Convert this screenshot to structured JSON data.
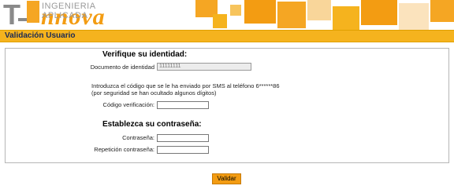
{
  "brand": {
    "logo_text": "T-Innova",
    "tagline": "INGENIERIA APLICADA"
  },
  "colors": {
    "accent": "#f5b31e",
    "orange": "#f39c12",
    "title_text": "#1b2a55"
  },
  "header": {
    "title": "Validación Usuario"
  },
  "identity": {
    "heading": "Verifique su identidad:",
    "document_label": "Documento de identidad",
    "document_value": "11111111",
    "sms_line1": "Introduzca el código que se le ha enviado por SMS al teléfono 6******86",
    "sms_line2": "(por seguridad se han ocultado algunos dígitos)",
    "code_label": "Código verificación:",
    "code_value": ""
  },
  "password": {
    "heading": "Establezca su contraseña:",
    "password_label": "Contraseña:",
    "password_value": "",
    "repeat_label": "Repetición contraseña:",
    "repeat_value": ""
  },
  "actions": {
    "validate_label": "Validar"
  }
}
